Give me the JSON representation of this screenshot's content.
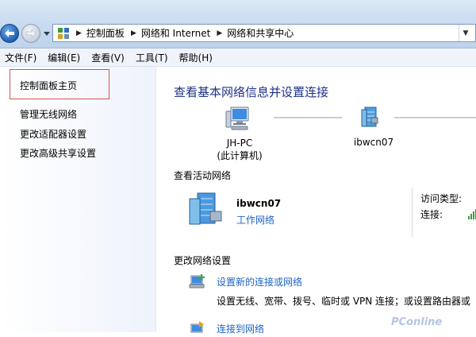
{
  "address_bar": {
    "crumbs": [
      "控制面板",
      "网络和 Internet",
      "网络和共享中心"
    ]
  },
  "menu": [
    "文件(F)",
    "编辑(E)",
    "查看(V)",
    "工具(T)",
    "帮助(H)"
  ],
  "left_pane": {
    "home": "控制面板主页",
    "links": [
      "管理无线网络",
      "更改适配器设置",
      "更改高级共享设置"
    ]
  },
  "main": {
    "title": "查看基本网络信息并设置连接",
    "map": {
      "computer_name": "JH-PC",
      "computer_sub": "(此计算机)",
      "network_name": "ibwcn07"
    },
    "active_section": "查看活动网络",
    "active_network": {
      "name": "ibwcn07",
      "type": "工作网络",
      "access_label": "访问类型:",
      "connection_label": "连接:"
    },
    "change_section": "更改网络设置",
    "tasks": [
      {
        "link": "设置新的连接或网络",
        "desc": "设置无线、宽带、拨号、临时或 VPN 连接；或设置路由器或"
      },
      {
        "link": "连接到网络",
        "desc": ""
      }
    ]
  },
  "watermark": "PConline",
  "colors": {
    "title": "#1e3287",
    "link": "#1c64c8",
    "highlight": "#d9534f"
  }
}
